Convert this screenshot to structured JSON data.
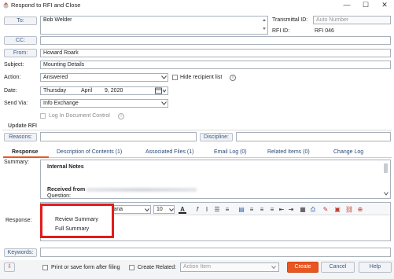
{
  "window": {
    "title": "Respond to RFI and Close",
    "minimize": "—",
    "maximize": "☐",
    "close": "✕"
  },
  "to": {
    "label": "To:",
    "value": "Bob Welder"
  },
  "transmittal": {
    "label": "Transmittal ID:",
    "placeholder": "Auto Number"
  },
  "rfi": {
    "label": "RFI ID:",
    "value": "RFI 046"
  },
  "cc": {
    "label": "CC:",
    "value": ""
  },
  "from": {
    "label": "From:",
    "value": "Howard Roark"
  },
  "subject": {
    "label": "Subject:",
    "value": "Mounting Details"
  },
  "action": {
    "label": "Action:",
    "value": "Answered",
    "hide_label": "Hide recipient list"
  },
  "date": {
    "label": "Date:",
    "day": "Thursday",
    "month": "April",
    "num": "9, 2020"
  },
  "send_via": {
    "label": "Send Via:",
    "value": "Info Exchange",
    "log_label": "Log In Document Control"
  },
  "update_rfi": {
    "title": "Update RFI",
    "reasons": "Reasons:",
    "discipline": "Discipline:"
  },
  "tabs": [
    {
      "label": "Response"
    },
    {
      "label": "Description of Contents (1)"
    },
    {
      "label": "Associated Files (1)"
    },
    {
      "label": "Email Log (0)"
    },
    {
      "label": "Related Items (0)"
    },
    {
      "label": "Change Log"
    }
  ],
  "summary": {
    "label": "Summary:",
    "internal_notes": "Internal Notes",
    "received_from": "Received from",
    "question": "Question:"
  },
  "editor": {
    "font": "Verdana",
    "size": "10",
    "bold": "B",
    "italic": "I",
    "underline": "U",
    "strike": "S"
  },
  "popup": {
    "items": [
      "Review Summary",
      "Full Summary"
    ]
  },
  "response": {
    "label": "Response:"
  },
  "keywords": {
    "label": "Keywords:"
  },
  "footer": {
    "print_label": "Print or save form after filing",
    "create_related_label": "Create Related:",
    "action_item": "Action Item",
    "create": "Create",
    "cancel": "Cancel",
    "help": "Help"
  }
}
